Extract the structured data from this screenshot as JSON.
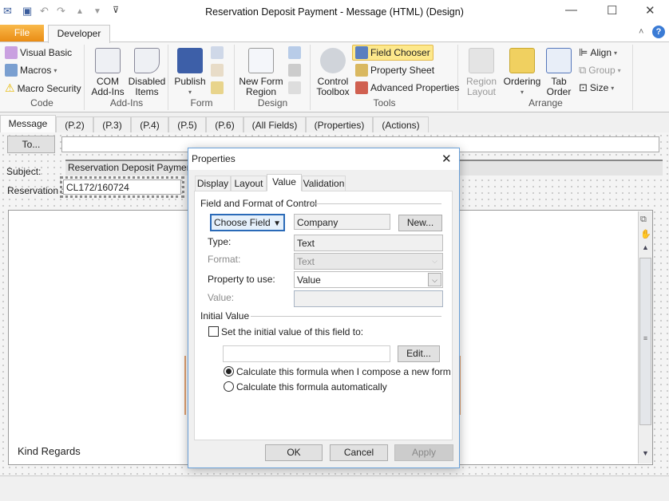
{
  "window": {
    "title": "Reservation Deposit Payment  -  Message (HTML)  (Design)",
    "minimize": "—",
    "maximize": "☐",
    "close": "✕"
  },
  "ribbon": {
    "tabs": [
      {
        "label": "File"
      },
      {
        "label": "Developer"
      }
    ],
    "groups": {
      "code": {
        "label": "Code",
        "items": [
          "Visual Basic",
          "Macros",
          "Macro Security"
        ]
      },
      "addins": {
        "label": "Add-Ins",
        "com": [
          "COM",
          "Add-Ins"
        ],
        "disabled": [
          "Disabled",
          "Items"
        ]
      },
      "form": {
        "label": "Form",
        "publish": "Publish"
      },
      "design": {
        "label": "Design",
        "new_form_region": [
          "New Form",
          "Region"
        ]
      },
      "tools": {
        "label": "Tools",
        "control_toolbox": [
          "Control",
          "Toolbox"
        ],
        "items": [
          "Field Chooser",
          "Property Sheet",
          "Advanced Properties"
        ]
      },
      "arrange": {
        "label": "Arrange",
        "region_layout": [
          "Region",
          "Layout"
        ],
        "ordering": "Ordering",
        "tab_order": [
          "Tab",
          "Order"
        ],
        "items": [
          "Align",
          "Group",
          "Size"
        ]
      }
    }
  },
  "form": {
    "tabs": [
      "Message",
      "(P.2)",
      "(P.3)",
      "(P.4)",
      "(P.5)",
      "(P.6)",
      "(All Fields)",
      "(Properties)",
      "(Actions)"
    ],
    "to_button": "To...",
    "to_value": "",
    "subject_label": "Subject:",
    "subject_value": "Reservation Deposit Payment",
    "reservation_label": "Reservation :",
    "reservation_value": "CL172/160724",
    "body_text": "Kind Regards"
  },
  "dialog": {
    "title": "Properties",
    "tabs": [
      "Display",
      "Layout",
      "Value",
      "Validation"
    ],
    "selected_tab": "Value",
    "section1": "Field and Format of Control",
    "choose_field": "Choose Field",
    "field_name": "Company",
    "new_button": "New...",
    "type_label": "Type:",
    "type_value": "Text",
    "format_label": "Format:",
    "format_value": "Text",
    "property_label": "Property to use:",
    "property_value": "Value",
    "value_label": "Value:",
    "value_value": "",
    "section2": "Initial Value",
    "set_initial": "Set the initial value of this field to:",
    "set_initial_checked": false,
    "initial_value": "",
    "edit_button": "Edit...",
    "radio_compose": "Calculate this formula when I compose a new form",
    "radio_auto": "Calculate this formula automatically",
    "selected_radio": "compose",
    "ok": "OK",
    "cancel": "Cancel",
    "apply": "Apply"
  },
  "colors": {
    "file_tab": "#f0a030",
    "highlight": "#fde88b",
    "accent": "#3a7bd5"
  }
}
